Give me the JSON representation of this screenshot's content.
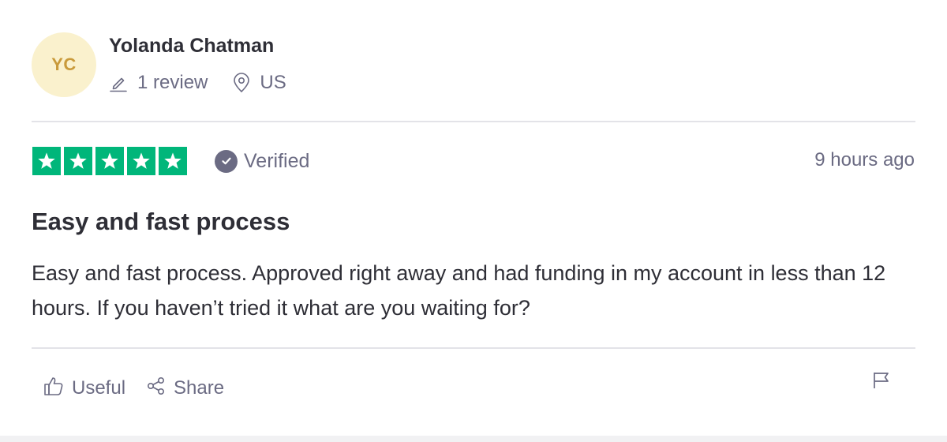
{
  "reviewer": {
    "initials": "YC",
    "name": "Yolanda Chatman",
    "review_count": "1 review",
    "location": "US",
    "avatar_bg": "#faf1cd",
    "avatar_fg": "#c99a3a"
  },
  "review": {
    "rating": 5,
    "rating_max": 5,
    "star_color": "#00b67a",
    "verified_label": "Verified",
    "time": "9 hours ago",
    "title": "Easy and fast process",
    "text": "Easy and fast process. Approved right away and had funding in my account in less than 12 hours. If you haven’t tried it what are you waiting for?"
  },
  "actions": {
    "useful_label": "Useful",
    "share_label": "Share"
  },
  "icons": {
    "review_count": "pencil-icon",
    "location": "location-pin-icon",
    "verified": "check-circle-icon",
    "useful": "thumbs-up-icon",
    "share": "share-icon",
    "report": "flag-icon",
    "star": "star-icon"
  }
}
